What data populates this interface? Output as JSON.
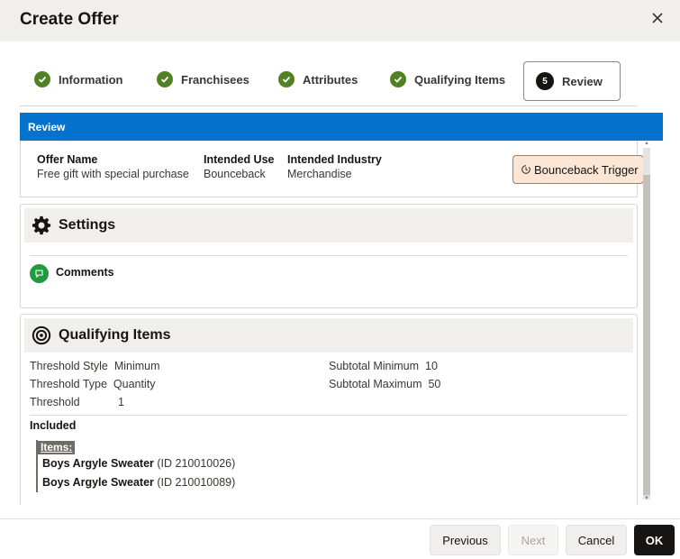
{
  "dialog": {
    "title": "Create Offer"
  },
  "train": {
    "steps": [
      {
        "label": "Information"
      },
      {
        "label": "Franchisees"
      },
      {
        "label": "Attributes"
      },
      {
        "label": "Qualifying Items"
      },
      {
        "label": "Review",
        "number": "5"
      }
    ]
  },
  "review": {
    "header": "Review",
    "offer_name": {
      "label": "Offer Name",
      "value": "Free gift with special purchase"
    },
    "intended_use": {
      "label": "Intended Use",
      "value": "Bounceback"
    },
    "intended_industry": {
      "label": "Intended Industry",
      "value": "Merchandise"
    },
    "trigger_button": "Bounceback Trigger"
  },
  "settings": {
    "title": "Settings",
    "comments_label": "Comments"
  },
  "qualifying": {
    "title": "Qualifying Items",
    "threshold_style": {
      "label": "Threshold Style",
      "value": "Minimum"
    },
    "threshold_type": {
      "label": "Threshold Type",
      "value": "Quantity"
    },
    "threshold": {
      "label": "Threshold",
      "value": "1"
    },
    "subtotal_minimum": {
      "label": "Subtotal Minimum",
      "value": "10"
    },
    "subtotal_maximum": {
      "label": "Subtotal Maximum",
      "value": "50"
    },
    "included_label": "Included",
    "items_label": "Items:",
    "items": [
      {
        "name": "Boys Argyle Sweater",
        "id": "(ID 210010026)"
      },
      {
        "name": "Boys Argyle Sweater",
        "id": "(ID 210010089)"
      }
    ]
  },
  "footer": {
    "previous": "Previous",
    "next": "Next",
    "cancel": "Cancel",
    "ok": "OK"
  },
  "colors": {
    "accent_blue": "#0572ce",
    "check_green": "#508223",
    "comment_green": "#1f9a3f",
    "trigger_bg": "#fbe5d4"
  }
}
